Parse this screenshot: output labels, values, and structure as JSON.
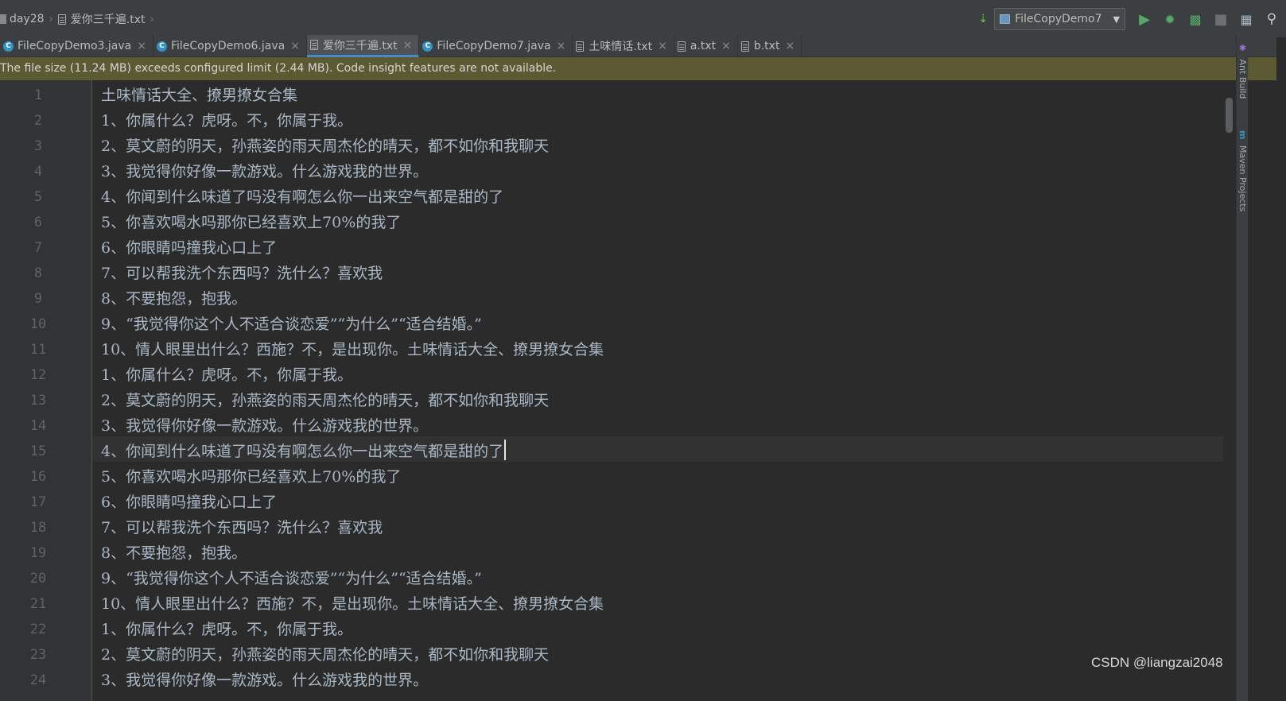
{
  "breadcrumb": {
    "items": [
      {
        "label": "day28"
      },
      {
        "label": "爱你三千遍.txt"
      }
    ]
  },
  "toolbar": {
    "run_config": "FileCopyDemo7"
  },
  "tabs": [
    {
      "label": "FileCopyDemo3.java",
      "type": "java",
      "active": false
    },
    {
      "label": "FileCopyDemo6.java",
      "type": "java",
      "active": false
    },
    {
      "label": "爱你三千遍.txt",
      "type": "txt",
      "active": true
    },
    {
      "label": "FileCopyDemo7.java",
      "type": "java",
      "active": false
    },
    {
      "label": "土味情话.txt",
      "type": "txt",
      "active": false
    },
    {
      "label": "a.txt",
      "type": "txt",
      "active": false
    },
    {
      "label": "b.txt",
      "type": "txt",
      "active": false
    }
  ],
  "banner": {
    "text": "The file size (11.24 MB) exceeds configured limit (2.44 MB). Code insight features are not available."
  },
  "editor": {
    "current_line": 15,
    "lines": [
      "土味情话大全、撩男撩女合集",
      "1、你属什么？虎呀。不，你属于我。",
      "2、莫文蔚的阴天，孙燕姿的雨天周杰伦的晴天，都不如你和我聊天",
      "3、我觉得你好像一款游戏。什么游戏我的世界。",
      "4、你闻到什么味道了吗没有啊怎么你一出来空气都是甜的了",
      "5、你喜欢喝水吗那你已经喜欢上70%的我了",
      "6、你眼睛吗撞我心口上了",
      "7、可以帮我洗个东西吗？洗什么？喜欢我",
      "8、不要抱怨，抱我。",
      "9、“我觉得你这个人不适合谈恋爱”“为什么”“适合结婚。”",
      "10、情人眼里出什么？西施？不，是出现你。土味情话大全、撩男撩女合集",
      "1、你属什么？虎呀。不，你属于我。",
      "2、莫文蔚的阴天，孙燕姿的雨天周杰伦的晴天，都不如你和我聊天",
      "3、我觉得你好像一款游戏。什么游戏我的世界。",
      "4、你闻到什么味道了吗没有啊怎么你一出来空气都是甜的了",
      "5、你喜欢喝水吗那你已经喜欢上70%的我了",
      "6、你眼睛吗撞我心口上了",
      "7、可以帮我洗个东西吗？洗什么？喜欢我",
      "8、不要抱怨，抱我。",
      "9、“我觉得你这个人不适合谈恋爱”“为什么”“适合结婚。”",
      "10、情人眼里出什么？西施？不，是出现你。土味情话大全、撩男撩女合集",
      "1、你属什么？虎呀。不，你属于我。",
      "2、莫文蔚的阴天，孙燕姿的雨天周杰伦的晴天，都不如你和我聊天",
      "3、我觉得你好像一款游戏。什么游戏我的世界。"
    ]
  },
  "right_panel": {
    "ant_build": "Ant Build",
    "maven_projects": "Maven Projects"
  },
  "watermark": "CSDN @liangzai2048",
  "colors": {
    "background": "#2b2b2b",
    "banner": "#5b5a33",
    "active_tab_underline": "#4a88c7",
    "run_green": "#59a869"
  }
}
